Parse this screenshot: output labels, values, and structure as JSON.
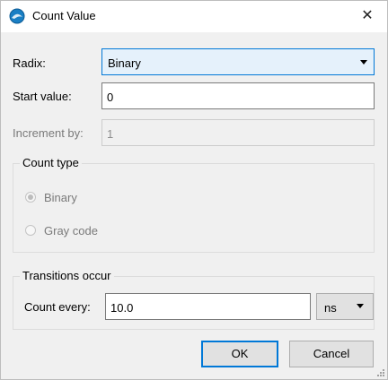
{
  "window": {
    "title": "Count Value",
    "close_glyph": "✕"
  },
  "radix": {
    "label": "Radix:",
    "value": "Binary"
  },
  "start": {
    "label": "Start value:",
    "value": "0"
  },
  "increment": {
    "label": "Increment by:",
    "value": "1"
  },
  "count_type": {
    "title": "Count type",
    "options": [
      {
        "label": "Binary",
        "selected": true
      },
      {
        "label": "Gray code",
        "selected": false
      }
    ]
  },
  "transitions": {
    "title": "Transitions occur",
    "count_every_label": "Count every:",
    "count_every_value": "10.0",
    "unit": "ns"
  },
  "buttons": {
    "ok": "OK",
    "cancel": "Cancel"
  },
  "colors": {
    "accent": "#0078d7",
    "radix_bg": "#e5f1fb",
    "disabled_text": "#7a7a7a"
  }
}
